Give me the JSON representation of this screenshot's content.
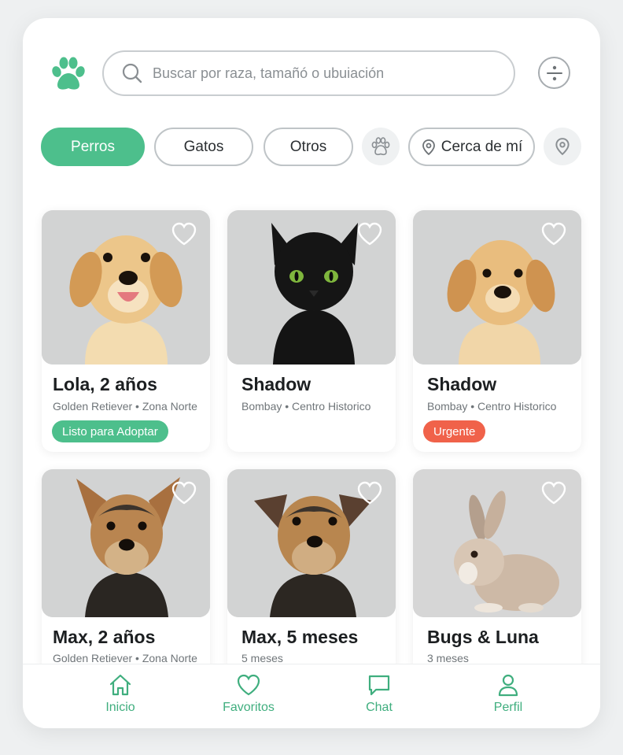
{
  "search": {
    "placeholder": "Buscar por raza, tamañó o ubuiación"
  },
  "filters": {
    "chips": [
      {
        "label": "Perros",
        "active": true
      },
      {
        "label": "Gatos",
        "active": false
      },
      {
        "label": "Otros",
        "active": false
      },
      {
        "label": "Cerca de mí",
        "active": false
      }
    ]
  },
  "colors": {
    "accent": "#4dbf8c",
    "urgent": "#f0624a",
    "photo_bg": "#d2d3d3"
  },
  "pets": [
    {
      "name": "Lola, 2 años",
      "meta": "Golden Retiever • Zona Norte",
      "badge": "Listo para Adoptar",
      "animal": "golden-puppy"
    },
    {
      "name": "Shadow",
      "meta": "Bombay • Centro Historico",
      "badge": "",
      "animal": "black-cat"
    },
    {
      "name": "Shadow",
      "meta": "Bombay • Centro Historico",
      "badge": "Urgente",
      "animal": "golden-puppy"
    },
    {
      "name": "Max, 2 años",
      "meta": "Golden Retiever • Zona Norte",
      "badge": "",
      "animal": "terrier"
    },
    {
      "name": "Max, 5 meses",
      "meta": "5 meses",
      "badge": "",
      "animal": "terrier"
    },
    {
      "name": "Bugs & Luna",
      "meta": "3 meses",
      "badge": "",
      "animal": "rabbit"
    }
  ],
  "nav": [
    {
      "label": "Inicio",
      "icon": "home-icon"
    },
    {
      "label": "Favoritos",
      "icon": "heart-icon"
    },
    {
      "label": "Chat",
      "icon": "chat-icon"
    },
    {
      "label": "Perfil",
      "icon": "user-icon"
    }
  ]
}
